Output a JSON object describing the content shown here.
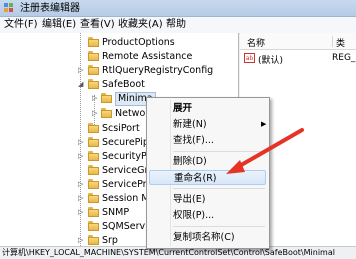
{
  "window": {
    "title": "注册表编辑器"
  },
  "menu": [
    "文件(F)",
    "编辑(E)",
    "查看(V)",
    "收藏夹(A)",
    "帮助"
  ],
  "tree": [
    {
      "label": "ProductOptions"
    },
    {
      "label": "Remote Assistance"
    },
    {
      "label": "RtlQueryRegistryConfig"
    },
    {
      "label": "SafeBoot"
    },
    {
      "label": "Minima"
    },
    {
      "label": "Networ"
    },
    {
      "label": "ScsiPort"
    },
    {
      "label": "SecurePipe"
    },
    {
      "label": "SecurityPro"
    },
    {
      "label": "ServiceGro"
    },
    {
      "label": "ServiceProv"
    },
    {
      "label": "Session Ma"
    },
    {
      "label": "SNMP"
    },
    {
      "label": "SQMService"
    },
    {
      "label": "Srp"
    }
  ],
  "values_pane": {
    "headers": {
      "name": "名称",
      "type": "类"
    },
    "rows": [
      {
        "name": "(默认)",
        "type": "REG_",
        "icon_text": "ab"
      }
    ]
  },
  "context_menu": {
    "items": [
      "展开",
      "新建(N)",
      "查找(F)...",
      "删除(D)",
      "重命名(R)",
      "导出(E)",
      "权限(P)...",
      "复制项名称(C)"
    ],
    "submenu_arrow": "▶"
  },
  "statusbar": {
    "path": "计算机\\HKEY_LOCAL_MACHINE\\SYSTEM\\CurrentControlSet\\Control\\SafeBoot\\Minimal"
  },
  "colors": {
    "annotation_arrow": "#e53325",
    "hover_bg": "#d7e7f8",
    "folder": "#f0c860"
  }
}
